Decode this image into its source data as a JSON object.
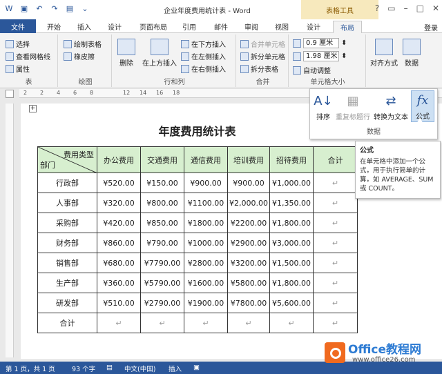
{
  "window": {
    "title": "企业年度费用统计表 - Word",
    "context_group": "表格工具",
    "help": "?",
    "login": "登录"
  },
  "tabs": [
    "文件",
    "开始",
    "插入",
    "设计",
    "页面布局",
    "引用",
    "邮件",
    "审阅",
    "视图",
    "设计",
    "布局"
  ],
  "ribbon": {
    "table": {
      "label": "表",
      "items": [
        "选择",
        "查看网格线",
        "属性"
      ]
    },
    "draw": {
      "label": "绘图",
      "items": [
        "绘制表格",
        "橡皮擦"
      ]
    },
    "delete": {
      "label": "删除"
    },
    "rows_cols": {
      "label": "行和列",
      "insert_above": "在上方插入",
      "items": [
        "在下方插入",
        "在左侧插入",
        "在右侧插入"
      ]
    },
    "merge": {
      "label": "合并",
      "items": [
        "合并单元格",
        "拆分单元格",
        "拆分表格"
      ]
    },
    "cell_size": {
      "label": "单元格大小",
      "height": "0.9 厘米",
      "width": "1.98 厘米",
      "autofit": "自动调整"
    },
    "align": {
      "label": "对齐方式"
    },
    "data": {
      "label": "数据"
    }
  },
  "ruler": [
    "2",
    "2",
    "4",
    "6",
    "8",
    "12",
    "14",
    "16",
    "18"
  ],
  "document": {
    "title": "年度费用统计表",
    "header": {
      "type_label": "费用类型",
      "dept_label": "部门",
      "cols": [
        "办公费用",
        "交通费用",
        "通信费用",
        "培训费用",
        "招待费用",
        "合计"
      ]
    },
    "rows": [
      {
        "dept": "行政部",
        "vals": [
          "¥520.00",
          "¥150.00",
          "¥900.00",
          "¥900.00",
          "¥1,000.00"
        ]
      },
      {
        "dept": "人事部",
        "vals": [
          "¥320.00",
          "¥800.00",
          "¥1100.00",
          "¥2,000.00",
          "¥1,350.00"
        ]
      },
      {
        "dept": "采购部",
        "vals": [
          "¥420.00",
          "¥850.00",
          "¥1800.00",
          "¥2200.00",
          "¥1,800.00"
        ]
      },
      {
        "dept": "财务部",
        "vals": [
          "¥860.00",
          "¥790.00",
          "¥1000.00",
          "¥2900.00",
          "¥3,000.00"
        ]
      },
      {
        "dept": "销售部",
        "vals": [
          "¥680.00",
          "¥7790.00",
          "¥2800.00",
          "¥3200.00",
          "¥1,500.00"
        ]
      },
      {
        "dept": "生产部",
        "vals": [
          "¥360.00",
          "¥5790.00",
          "¥1600.00",
          "¥5800.00",
          "¥1,800.00"
        ]
      },
      {
        "dept": "研发部",
        "vals": [
          "¥510.00",
          "¥2790.00",
          "¥1900.00",
          "¥7800.00",
          "¥5,600.00"
        ]
      }
    ],
    "total_label": "合计"
  },
  "data_panel": {
    "sort": "排序",
    "repeat_header": "重复标题行",
    "convert": "转换为文本",
    "formula": "公式",
    "group_label": "数据"
  },
  "tooltip": {
    "title": "公式",
    "body": "在单元格中添加一个公式，用于执行简单的计算，如 AVERAGE、SUM 或 COUNT。"
  },
  "status": {
    "page": "第 1 页，共 1 页",
    "words": "93 个字",
    "lang": "中文(中国)",
    "mode": "插入"
  },
  "watermark": {
    "brand": "Office教程网",
    "url": "www.office26.com"
  },
  "colors": {
    "accent": "#2b579a",
    "header_fill": "#d7efcf"
  }
}
